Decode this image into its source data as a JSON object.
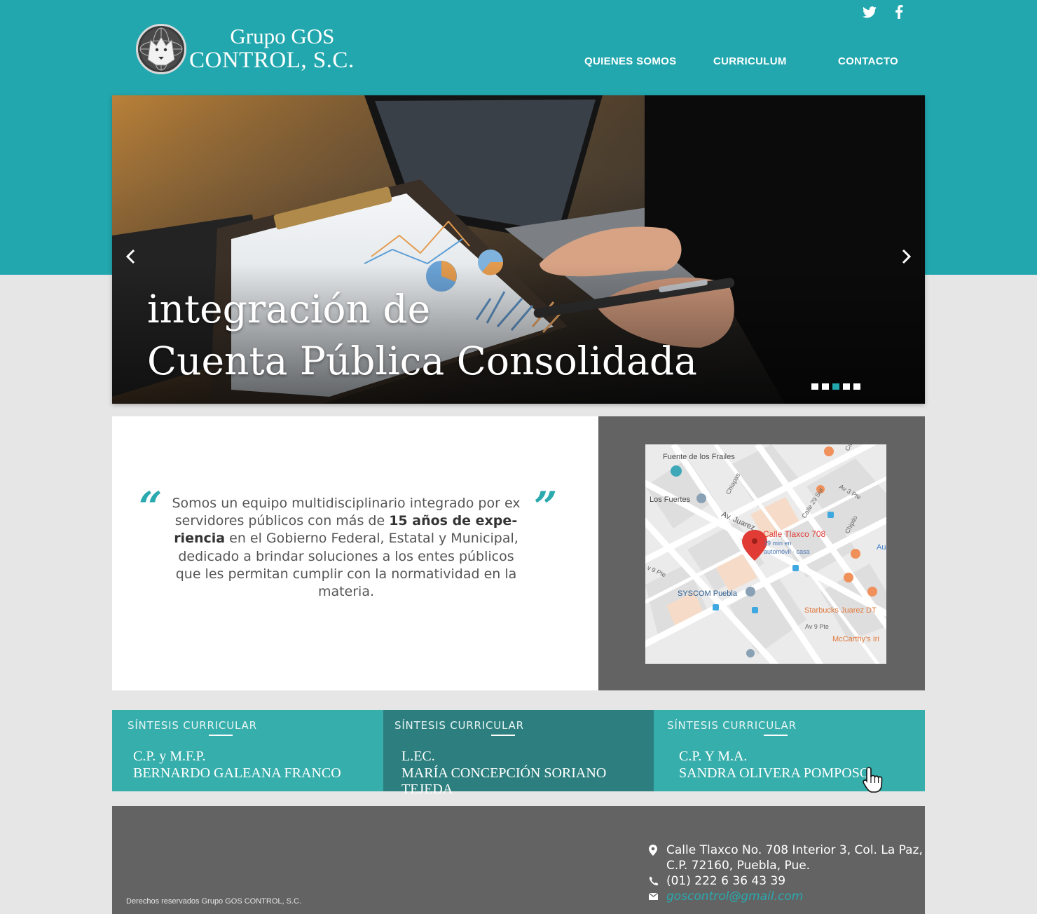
{
  "header": {
    "logo_line1": "Grupo GOS",
    "logo_line2": "CONTROL, S.C.",
    "social": [
      "twitter-icon",
      "facebook-icon"
    ],
    "nav": [
      {
        "label": "QUIENES SOMOS"
      },
      {
        "label": "CURRICULUM"
      },
      {
        "label": "CONTACTO"
      }
    ]
  },
  "slider": {
    "caption_line1": "integración de",
    "caption_line2": "Cuenta Pública Consolidada",
    "slide_count": 5,
    "active_slide": 3
  },
  "about": {
    "quote_open": "“",
    "quote_close": "”",
    "text_before": "Somos un equipo multidisciplinario integrado por ex servidores públicos con más de ",
    "text_bold": "15 años de expe­riencia",
    "text_after": " en el Gobierno Federal, Estatal y Municipal, dedicado a brindar soluciones a los entes públicos que les permitan cumplir con la normatividad en la materia."
  },
  "map": {
    "labels": {
      "fuente": "Fuente de los Frailes",
      "fuertes": "Los Fuertes",
      "av_juarez": "Av. Juarez",
      "place_name": "Calle Tlaxco 708",
      "place_sub1": "29 min en",
      "place_sub2": "automóvil · casa",
      "syscom": "SYSCOM Puebla",
      "starbucks": "Starbucks Juarez DT",
      "mccarthys": "McCarthy's Iri",
      "av9pte": "Av 9 Pte",
      "av9pte_left": "v 9 Pte",
      "av3pte": "Av 3 Pte",
      "calle29": "Calle 29 Sur",
      "chiapas": "Chiapas",
      "chiplo": "Chipilo",
      "au": "Au",
      "ca": "Ca"
    }
  },
  "curriculum": {
    "cards": [
      {
        "heading": "SÍNTESIS CURRICULAR",
        "line1": "C.P. y M.F.P.",
        "line2": "BERNARDO GALEANA FRANCO"
      },
      {
        "heading": "SÍNTESIS CURRICULAR",
        "line1": "L.EC.",
        "line2": "MARÍA CONCEPCIÓN SORIANO TEJEDA"
      },
      {
        "heading": "SÍNTESIS CURRICULAR",
        "line1": "C.P. Y M.A.",
        "line2": "SANDRA OLIVERA POMPOSO"
      }
    ]
  },
  "footer": {
    "copyright": "Derechos reservados Grupo GOS CONTROL, S.C.",
    "address_line1": "Calle Tlaxco No. 708 Interior 3, Col. La Paz,",
    "address_line2": "C.P. 72160, Puebla, Pue.",
    "phone": "(01) 222 6 36 43 39",
    "email": "goscontrol@gmail.com"
  },
  "colors": {
    "brand": "#22a7ae",
    "card": "#36aeab",
    "card_active": "#2d7f7f",
    "dark_panel": "#636363",
    "page_bg": "#e6e6e6"
  }
}
